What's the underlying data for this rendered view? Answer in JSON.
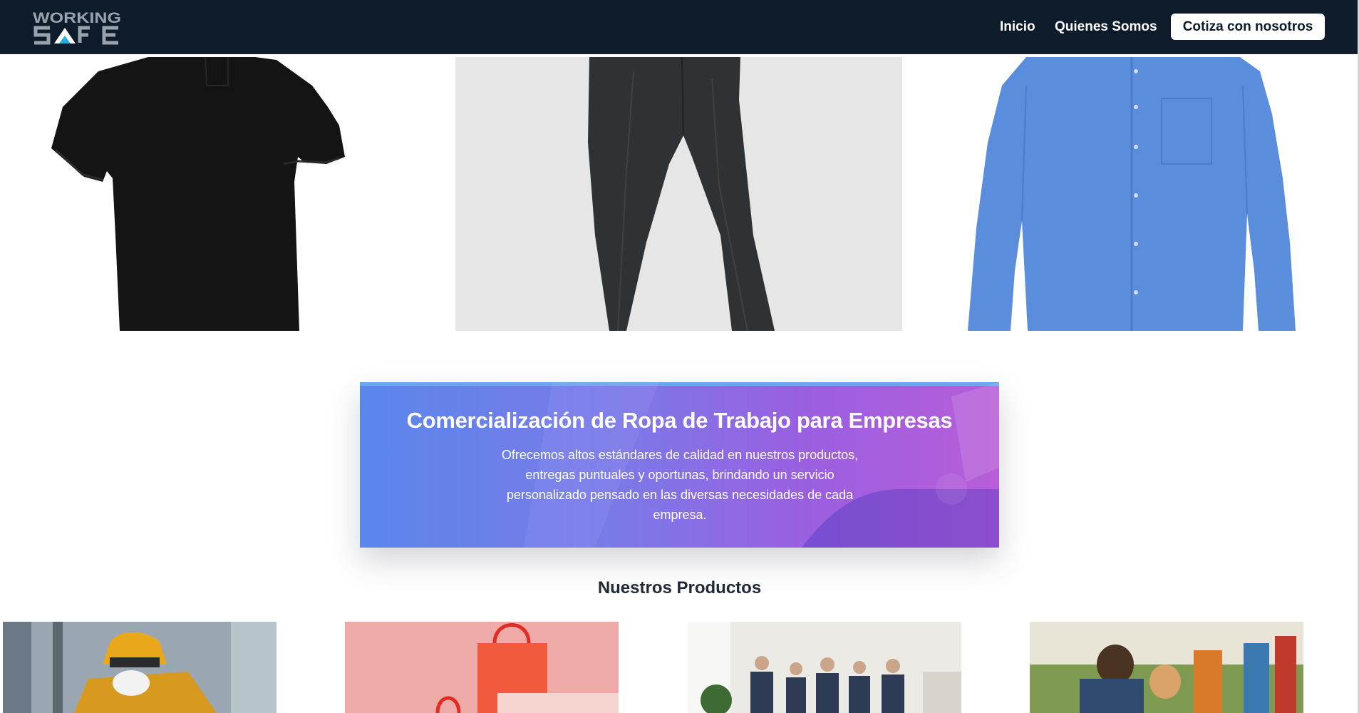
{
  "brand": {
    "logo_text_top": "WORKING",
    "logo_text_bottom": "SAFE"
  },
  "nav": {
    "links": [
      "Inicio",
      "Quienes Somos"
    ],
    "cta_label": "Cotiza con nosotros"
  },
  "hero_images": [
    {
      "name": "polo-negra",
      "icon": "black-polo-shirt"
    },
    {
      "name": "pantalon-gris",
      "icon": "grey-trousers"
    },
    {
      "name": "camisa-azul",
      "icon": "blue-shirt"
    }
  ],
  "banner": {
    "title": "Comercialización de Ropa de Trabajo para Empresas",
    "text": "Ofrecemos altos estándares de calidad en nuestros productos, entregas puntuales y oportunas, brindando un servicio personalizado pensado en las diversas necesidades de cada empresa."
  },
  "products": {
    "title": "Nuestros Productos",
    "cards": [
      {
        "icon": "construction-worker-photo"
      },
      {
        "icon": "shopping-bags-photo"
      },
      {
        "icon": "office-team-photo"
      },
      {
        "icon": "hikers-photo"
      }
    ]
  },
  "colors": {
    "navbar_bg": "#0d1b2a",
    "accent_blue": "#29a9e1",
    "banner_start": "#5a87ec",
    "banner_end": "#b85ed8"
  }
}
